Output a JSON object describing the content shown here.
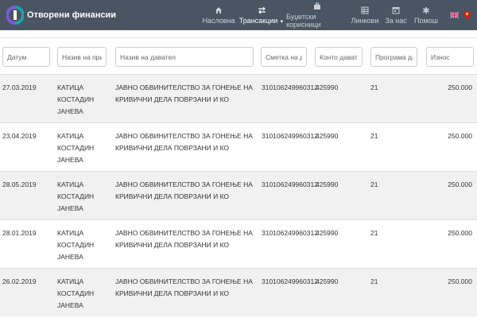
{
  "navbar": {
    "brand": "Отворени финансии",
    "items": [
      {
        "label": "Насловна",
        "icon": "home-icon"
      },
      {
        "label": "Трансакции",
        "icon": "transfer-icon",
        "active": true,
        "dropdown": true
      },
      {
        "label": "Буџетски корисници",
        "icon": "briefcase-icon"
      },
      {
        "label": "Линкови",
        "icon": "grid-icon"
      },
      {
        "label": "За нас",
        "icon": "calendar-icon"
      },
      {
        "label": "Помош",
        "icon": "asterisk-icon"
      }
    ],
    "flags": [
      "uk-flag-icon",
      "mk-flag-icon"
    ]
  },
  "filters": {
    "date": "Датум",
    "recipient": "Назив на прим",
    "payer": "Назив на давател",
    "account": "Сметка на дав",
    "konto": "Конто давател",
    "program": "Програма дав",
    "amount": "Износ"
  },
  "rows": [
    {
      "date": "27.03.2019",
      "name": "КАТИЦА КОСТАДИН ЈАНЕВА",
      "payer": "ЈАВНО ОБВИНИТЕЛСТВО ЗА ГОНЕЊЕ НА КРИВИЧНИ ДЕЛА ПОВРЗАНИ И КО",
      "account": "310106249960312",
      "konto": "425990",
      "program": "21",
      "amount": "250.000"
    },
    {
      "date": "23.04.2019",
      "name": "КАТИЦА КОСТАДИН ЈАНЕВА",
      "payer": "ЈАВНО ОБВИНИТЕЛСТВО ЗА ГОНЕЊЕ НА КРИВИЧНИ ДЕЛА ПОВРЗАНИ И КО",
      "account": "310106249960312",
      "konto": "425990",
      "program": "21",
      "amount": "250.000"
    },
    {
      "date": "28.05.2019",
      "name": "КАТИЦА КОСТАДИН ЈАНЕВА",
      "payer": "ЈАВНО ОБВИНИТЕЛСТВО ЗА ГОНЕЊЕ НА КРИВИЧНИ ДЕЛА ПОВРЗАНИ И КО",
      "account": "310106249960312",
      "konto": "425990",
      "program": "21",
      "amount": "250.000"
    },
    {
      "date": "28.01.2019",
      "name": "КАТИЦА КОСТАДИН ЈАНЕВА",
      "payer": "ЈАВНО ОБВИНИТЕЛСТВО ЗА ГОНЕЊЕ НА КРИВИЧНИ ДЕЛА ПОВРЗАНИ И КО",
      "account": "310106249960312",
      "konto": "425990",
      "program": "21",
      "amount": "250.000"
    },
    {
      "date": "26.02.2019",
      "name": "КАТИЦА КОСТАДИН ЈАНЕВА",
      "payer": "ЈАВНО ОБВИНИТЕЛСТВО ЗА ГОНЕЊЕ НА КРИВИЧНИ ДЕЛА ПОВРЗАНИ И КО",
      "account": "310106249960312",
      "konto": "425990",
      "program": "21",
      "amount": "250.000"
    }
  ]
}
